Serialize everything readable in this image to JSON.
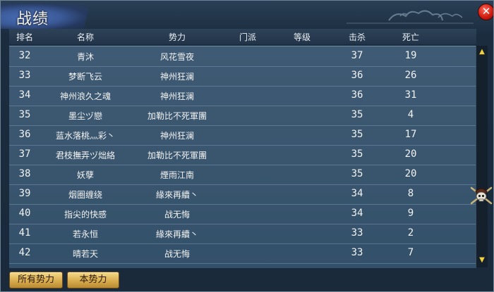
{
  "window": {
    "title": "战绩",
    "close_label": "✕"
  },
  "columns": [
    "排名",
    "名称",
    "势力",
    "门派",
    "等级",
    "击杀",
    "死亡"
  ],
  "rows": [
    {
      "rank": "32",
      "name": "青沐",
      "faction": "风花雪夜",
      "sect": "",
      "level": "",
      "kills": "37",
      "deaths": "19"
    },
    {
      "rank": "33",
      "name": "梦断飞云",
      "faction": "神州狂澜",
      "sect": "",
      "level": "",
      "kills": "36",
      "deaths": "26"
    },
    {
      "rank": "34",
      "name": "神州浪久之魂",
      "faction": "神州狂澜",
      "sect": "",
      "level": "",
      "kills": "36",
      "deaths": "31"
    },
    {
      "rank": "35",
      "name": "墨尘ヅ戀",
      "faction": "加勒比不死軍團",
      "sect": "",
      "level": "",
      "kills": "35",
      "deaths": "4"
    },
    {
      "rank": "36",
      "name": "蓝水落桃灬彩丶",
      "faction": "神州狂澜",
      "sect": "",
      "level": "",
      "kills": "35",
      "deaths": "17"
    },
    {
      "rank": "37",
      "name": "君枝撫弄ヅ炪絡",
      "faction": "加勒比不死軍團",
      "sect": "",
      "level": "",
      "kills": "35",
      "deaths": "20"
    },
    {
      "rank": "38",
      "name": "妖孽",
      "faction": "煙雨江南",
      "sect": "",
      "level": "",
      "kills": "35",
      "deaths": "20"
    },
    {
      "rank": "39",
      "name": "烟圈缠绕",
      "faction": "緣來再續丶",
      "sect": "",
      "level": "",
      "kills": "34",
      "deaths": "8"
    },
    {
      "rank": "40",
      "name": "指尖的快感",
      "faction": "战无悔",
      "sect": "",
      "level": "",
      "kills": "34",
      "deaths": "9"
    },
    {
      "rank": "41",
      "name": "若永恒",
      "faction": "緣來再續丶",
      "sect": "",
      "level": "",
      "kills": "33",
      "deaths": "2"
    },
    {
      "rank": "42",
      "name": "晴若天",
      "faction": "战无悔",
      "sect": "",
      "level": "",
      "kills": "33",
      "deaths": "7"
    }
  ],
  "buttons": {
    "all_factions": "所有势力",
    "my_faction": "本势力"
  },
  "icons": {
    "close": "close-icon",
    "scroll_up": "up-arrow-icon",
    "scroll_down": "down-arrow-icon",
    "emblem": "skull-pirate-icon"
  },
  "colors": {
    "accent": "#f3d23c",
    "close": "#d01c10",
    "button": "#d9ad4f"
  }
}
